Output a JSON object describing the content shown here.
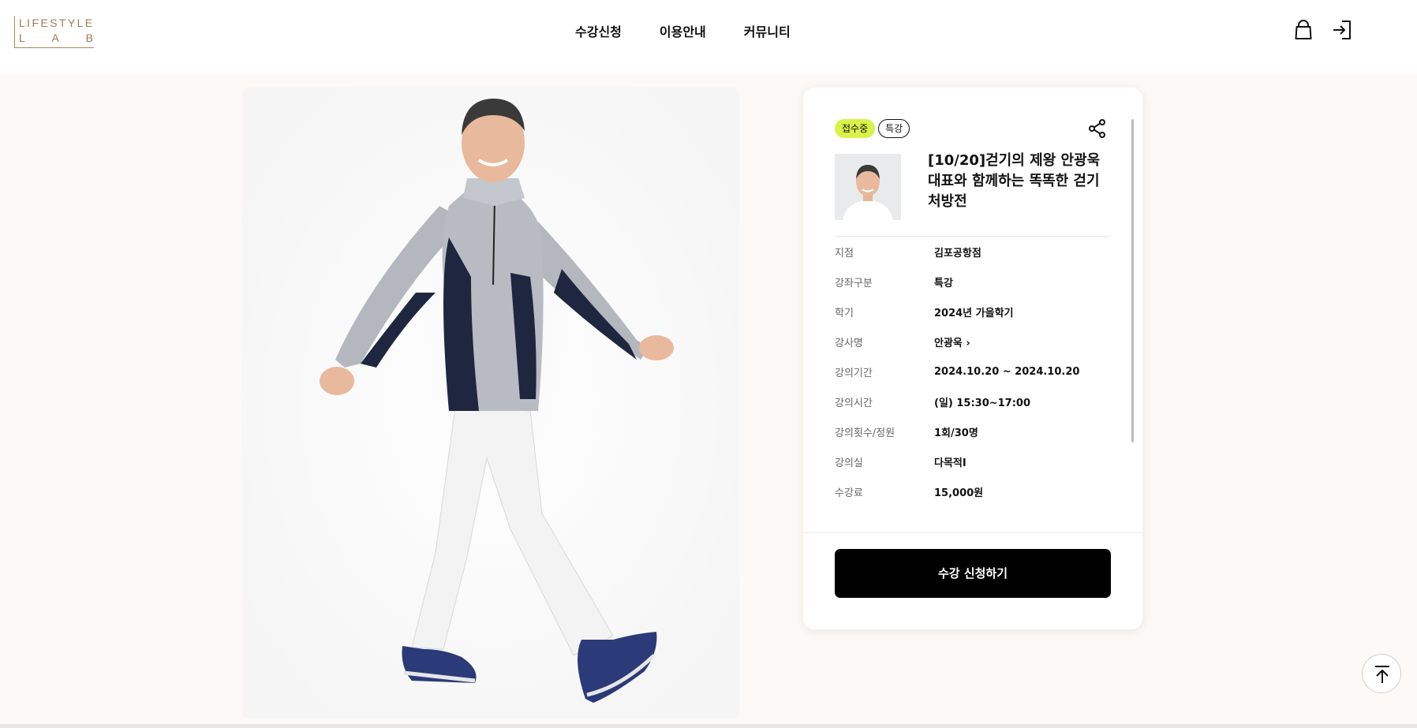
{
  "header": {
    "logo": {
      "line1": "LIFESTYLE",
      "line2": [
        "L",
        "A",
        "B"
      ]
    },
    "nav": [
      "수강신청",
      "이용안내",
      "커뮤니티"
    ],
    "icons": [
      "shopping-bag-icon",
      "login-icon"
    ]
  },
  "course": {
    "badges": {
      "status": "접수중",
      "type": "특강"
    },
    "title": "[10/20]걷기의 제왕 안광욱 대표와 함께하는 똑똑한 걷기 처방전",
    "details": [
      {
        "label": "지점",
        "value": "김포공항점"
      },
      {
        "label": "강좌구분",
        "value": "특강"
      },
      {
        "label": "학기",
        "value": "2024년 가을학기"
      },
      {
        "label": "강사명",
        "value": "안광욱 ›"
      },
      {
        "label": "강의기간",
        "value": "2024.10.20 ~ 2024.10.20"
      },
      {
        "label": "강의시간",
        "value": "(일) 15:30~17:00"
      },
      {
        "label": "강의횟수/정원",
        "value": "1회/30명"
      },
      {
        "label": "강의실",
        "value": "다목적Ⅰ"
      },
      {
        "label": "수강료",
        "value": "15,000원"
      }
    ],
    "apply_label": "수강 신청하기"
  },
  "colors": {
    "badge_open": "#d9f24a",
    "logo": "#9b7d55",
    "button": "#000000",
    "background": "#fdf9f6"
  }
}
